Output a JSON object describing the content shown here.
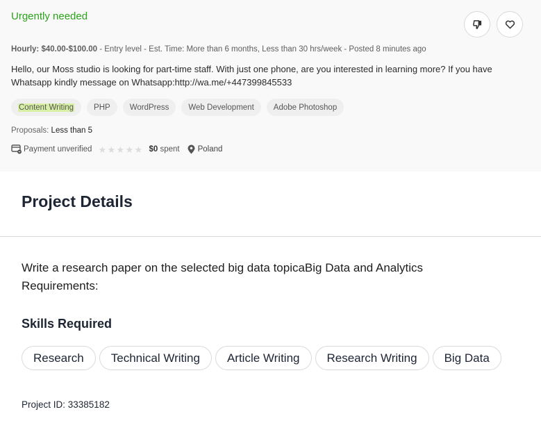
{
  "job": {
    "urgency_label": "Urgently needed",
    "actions": {
      "dislike_icon": "thumbs-down-icon",
      "save_icon": "heart-icon"
    },
    "meta": {
      "rate_type": "Hourly:",
      "rate": "$40.00-$100.00",
      "details": " - Entry level - Est. Time: More than 6 months, Less than 30 hrs/week - Posted 8 minutes ago"
    },
    "description": "Hello, our Moss studio is looking for part-time staff. With just one phone, are you interested in learning more? If you have Whatsapp kindly message on Whatsapp:http://wa.me/+447399845533",
    "tags": [
      {
        "label": "Content Writing",
        "highlighted": true
      },
      {
        "label": "PHP",
        "highlighted": false
      },
      {
        "label": "WordPress",
        "highlighted": false
      },
      {
        "label": "Web Development",
        "highlighted": false
      },
      {
        "label": "Adobe Photoshop",
        "highlighted": false
      }
    ],
    "proposals": {
      "label": "Proposals:",
      "value": "Less than 5"
    },
    "client": {
      "payment_status": "Payment unverified",
      "rating_stars": 0,
      "rating_max": 5,
      "spent_amount": "$0",
      "spent_label": "spent",
      "country": "Poland"
    }
  },
  "project": {
    "title": "Project Details",
    "description_line1": "Write a research paper on the selected big data topicaBig Data and Analytics",
    "description_line2": "Requirements:",
    "skills_title": "Skills Required",
    "skills": [
      "Research",
      "Technical Writing",
      "Article Writing",
      "Research Writing",
      "Big Data"
    ],
    "project_id": "Project ID: 33385182"
  },
  "colors": {
    "urgent_green": "#2ba31a",
    "tag_highlight": "#d8f0a6",
    "card_background": "#f9f9f9",
    "heading_navy": "#1d2433"
  }
}
